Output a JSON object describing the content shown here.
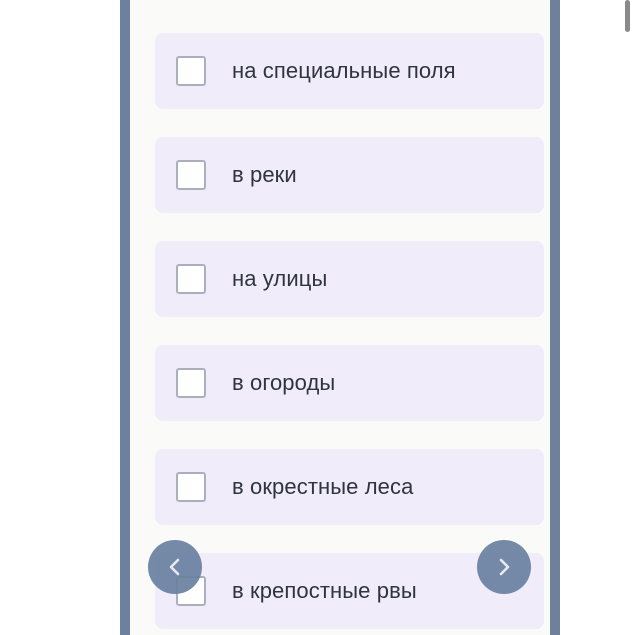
{
  "options": [
    {
      "label": "на специальные поля",
      "checked": false
    },
    {
      "label": "в реки",
      "checked": false
    },
    {
      "label": "на улицы",
      "checked": false
    },
    {
      "label": "в огороды",
      "checked": false
    },
    {
      "label": "в окрестные леса",
      "checked": false
    },
    {
      "label": "в крепостные рвы",
      "checked": false
    }
  ],
  "navigation": {
    "prev_icon": "chevron-left-icon",
    "next_icon": "chevron-right-icon"
  },
  "colors": {
    "frame": "#6d819d",
    "option_bg": "#f0ecfa",
    "nav_button": "#6880a0",
    "text": "#2f3440"
  }
}
